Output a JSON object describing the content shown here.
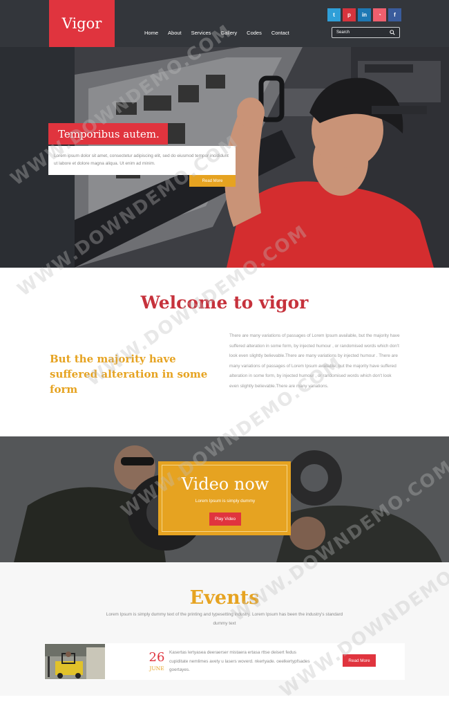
{
  "brand": {
    "logo": "Vigor"
  },
  "nav": {
    "items": [
      "Home",
      "About",
      "Services",
      "Gallery",
      "Codes",
      "Contact"
    ]
  },
  "social": [
    {
      "icon": "twitter-icon",
      "glyph": "t"
    },
    {
      "icon": "pinterest-icon",
      "glyph": "p"
    },
    {
      "icon": "linkedin-icon",
      "glyph": "in"
    },
    {
      "icon": "rss-icon",
      "glyph": "◔"
    },
    {
      "icon": "facebook-icon",
      "glyph": "f"
    }
  ],
  "search": {
    "placeholder": "Search"
  },
  "hero": {
    "title": "Temporibus autem.",
    "text": "Lorem ipsum dolor sit amet, consectetur adipiscing elit, sed do eiusmod tempor incididunt ut labore et dolore magna aliqua. Ut enim ad minim.",
    "button": "Read More"
  },
  "welcome": {
    "title": "Welcome to vigor",
    "subtitle": "But the majority have suffered alteration in some form",
    "paragraph": "There are many variations of passages of Lorem Ipsum available, but the majority have suffered alteration in some form, by injected humour , or randomised words which don't look even slightly believable.There are many variations by injected humour . There are many variations of passages of Lorem Ipsum available, but the majority have suffered alteration in some form, by injected humour , or randomised words which don't look even slightly believable.There are many variations."
  },
  "video": {
    "title": "Video now",
    "subtitle": "Lorem Ipsum is simply dummy",
    "button": "Play Video"
  },
  "events": {
    "title": "Events",
    "description": "Lorem Ipsum is simply dummy text of the printing and typesetting industry. Lorem Ipsum has been the industry's standard dummy text",
    "items": [
      {
        "day": "26",
        "month": "JUNE",
        "text": "Kasertas lertyasea deeraerser mistaera ertasa rttse deisert fedus cupiditate nemlimes avety u lasers woverd. nkertyade. oeelkertypfsades goertayes.",
        "button": "Read More"
      }
    ]
  },
  "watermark": "WWW.DOWNDEMO.COM",
  "colors": {
    "brand_red": "#e0343e",
    "accent_yellow": "#e6a321",
    "dark": "#33363b"
  }
}
